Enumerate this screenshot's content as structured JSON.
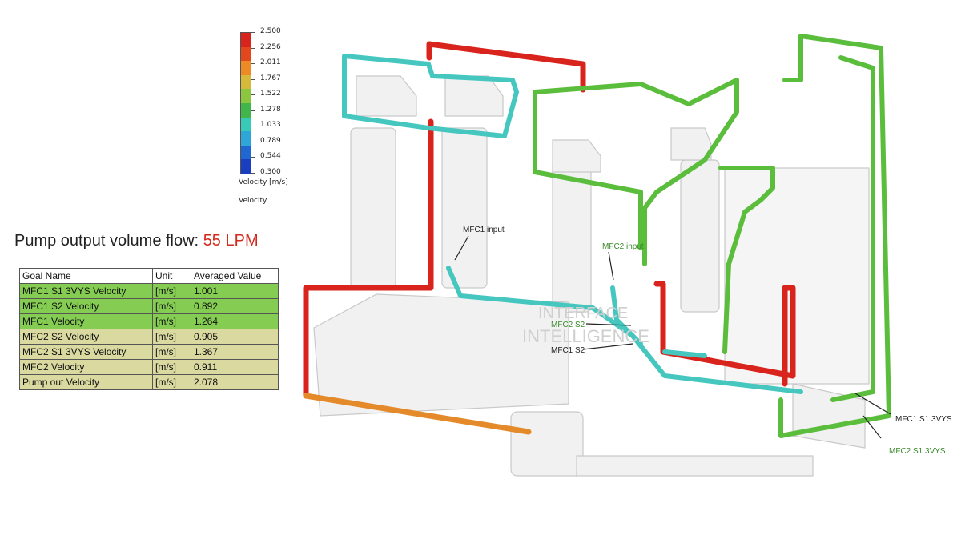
{
  "legend": {
    "ticks": [
      "2.500",
      "2.256",
      "2.011",
      "1.767",
      "1.522",
      "1.278",
      "1.033",
      "0.789",
      "0.544",
      "0.300"
    ],
    "colors": [
      "#d8241c",
      "#e3481d",
      "#ee8a25",
      "#d6b83a",
      "#8cc63f",
      "#3fb54a",
      "#39c9b7",
      "#2fa6d8",
      "#2167d1",
      "#1a3ec0"
    ],
    "unit_label": "Velocity [m/s]",
    "title": "Velocity"
  },
  "headline": {
    "label": "Pump output volume flow: ",
    "value": "55 LPM"
  },
  "table": {
    "headers": [
      "Goal Name",
      "Unit",
      "Averaged Value"
    ],
    "rows": [
      {
        "name": "MFC1 S1 3VYS Velocity",
        "unit": "[m/s]",
        "value": "1.001",
        "highlight": "green"
      },
      {
        "name": "MFC1 S2 Velocity",
        "unit": "[m/s]",
        "value": "0.892",
        "highlight": "green"
      },
      {
        "name": "MFC1 Velocity",
        "unit": "[m/s]",
        "value": "1.264",
        "highlight": "green"
      },
      {
        "name": "MFC2 S2 Velocity",
        "unit": "[m/s]",
        "value": "0.905",
        "highlight": "tan"
      },
      {
        "name": "MFC2 S1 3VYS Velocity",
        "unit": "[m/s]",
        "value": "1.367",
        "highlight": "tan"
      },
      {
        "name": "MFC2 Velocity",
        "unit": "[m/s]",
        "value": "0.911",
        "highlight": "tan"
      },
      {
        "name": "Pump out Velocity",
        "unit": "[m/s]",
        "value": "2.078",
        "highlight": "tan"
      }
    ]
  },
  "annotations": {
    "mfc1_input": "MFC1 input",
    "mfc2_input": "MFC2 input",
    "mfc2_s2": "MFC2 S2",
    "mfc1_s2": "MFC1 S2",
    "mfc1_s1_3vys": "MFC1 S1 3VYS",
    "mfc2_s1_3vys": "MFC2 S1 3VYS",
    "watermark_line1": "INTERFACE",
    "watermark_line2": "INTELLIGENCE"
  },
  "colors": {
    "red_pipe": "#d8241c",
    "green_pipe": "#5bbd3c",
    "cyan_pipe": "#45c7c0",
    "orange_pipe": "#e58a2a",
    "mfc1_text": "#111111",
    "mfc2_text": "#3a8a2a"
  }
}
